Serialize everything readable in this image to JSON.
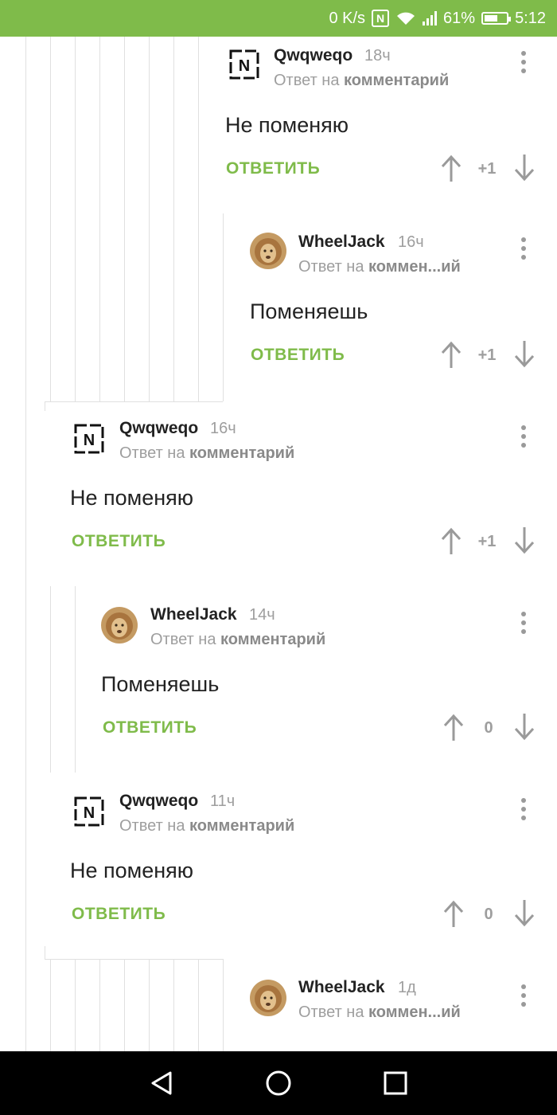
{
  "status": {
    "speed": "0 K/s",
    "nfc": "N",
    "battery": "61%",
    "battery_level": 0.61,
    "time": "5:12"
  },
  "comments": [
    {
      "user": "Qwqweqo",
      "time": "18ч",
      "reply_prefix": "Ответ на",
      "reply_target": "комментарий",
      "text": "Не поменяю",
      "reply": "ОТВЕТИТЬ",
      "score": "+1",
      "avatar": "rammstein-logo"
    },
    {
      "user": "WheelJack",
      "time": "16ч",
      "reply_prefix": "Ответ на",
      "reply_target": "коммен...ий",
      "text": "Поменяешь",
      "reply": "ОТВЕТИТЬ",
      "score": "+1",
      "avatar": "lion-photo"
    },
    {
      "user": "Qwqweqo",
      "time": "16ч",
      "reply_prefix": "Ответ на",
      "reply_target": "комментарий",
      "text": "Не поменяю",
      "reply": "ОТВЕТИТЬ",
      "score": "+1",
      "avatar": "rammstein-logo"
    },
    {
      "user": "WheelJack",
      "time": "14ч",
      "reply_prefix": "Ответ на",
      "reply_target": "комментарий",
      "text": "Поменяешь",
      "reply": "ОТВЕТИТЬ",
      "score": "0",
      "avatar": "lion-photo"
    },
    {
      "user": "Qwqweqo",
      "time": "11ч",
      "reply_prefix": "Ответ на",
      "reply_target": "комментарий",
      "text": "Не поменяю",
      "reply": "ОТВЕТИТЬ",
      "score": "0",
      "avatar": "rammstein-logo"
    },
    {
      "user": "WheelJack",
      "time": "1д",
      "reply_prefix": "Ответ на",
      "reply_target": "коммен...ий",
      "avatar": "lion-photo"
    }
  ],
  "colors": {
    "accent": "#7fbb4a",
    "text": "#222222",
    "muted": "#9e9e9e"
  }
}
